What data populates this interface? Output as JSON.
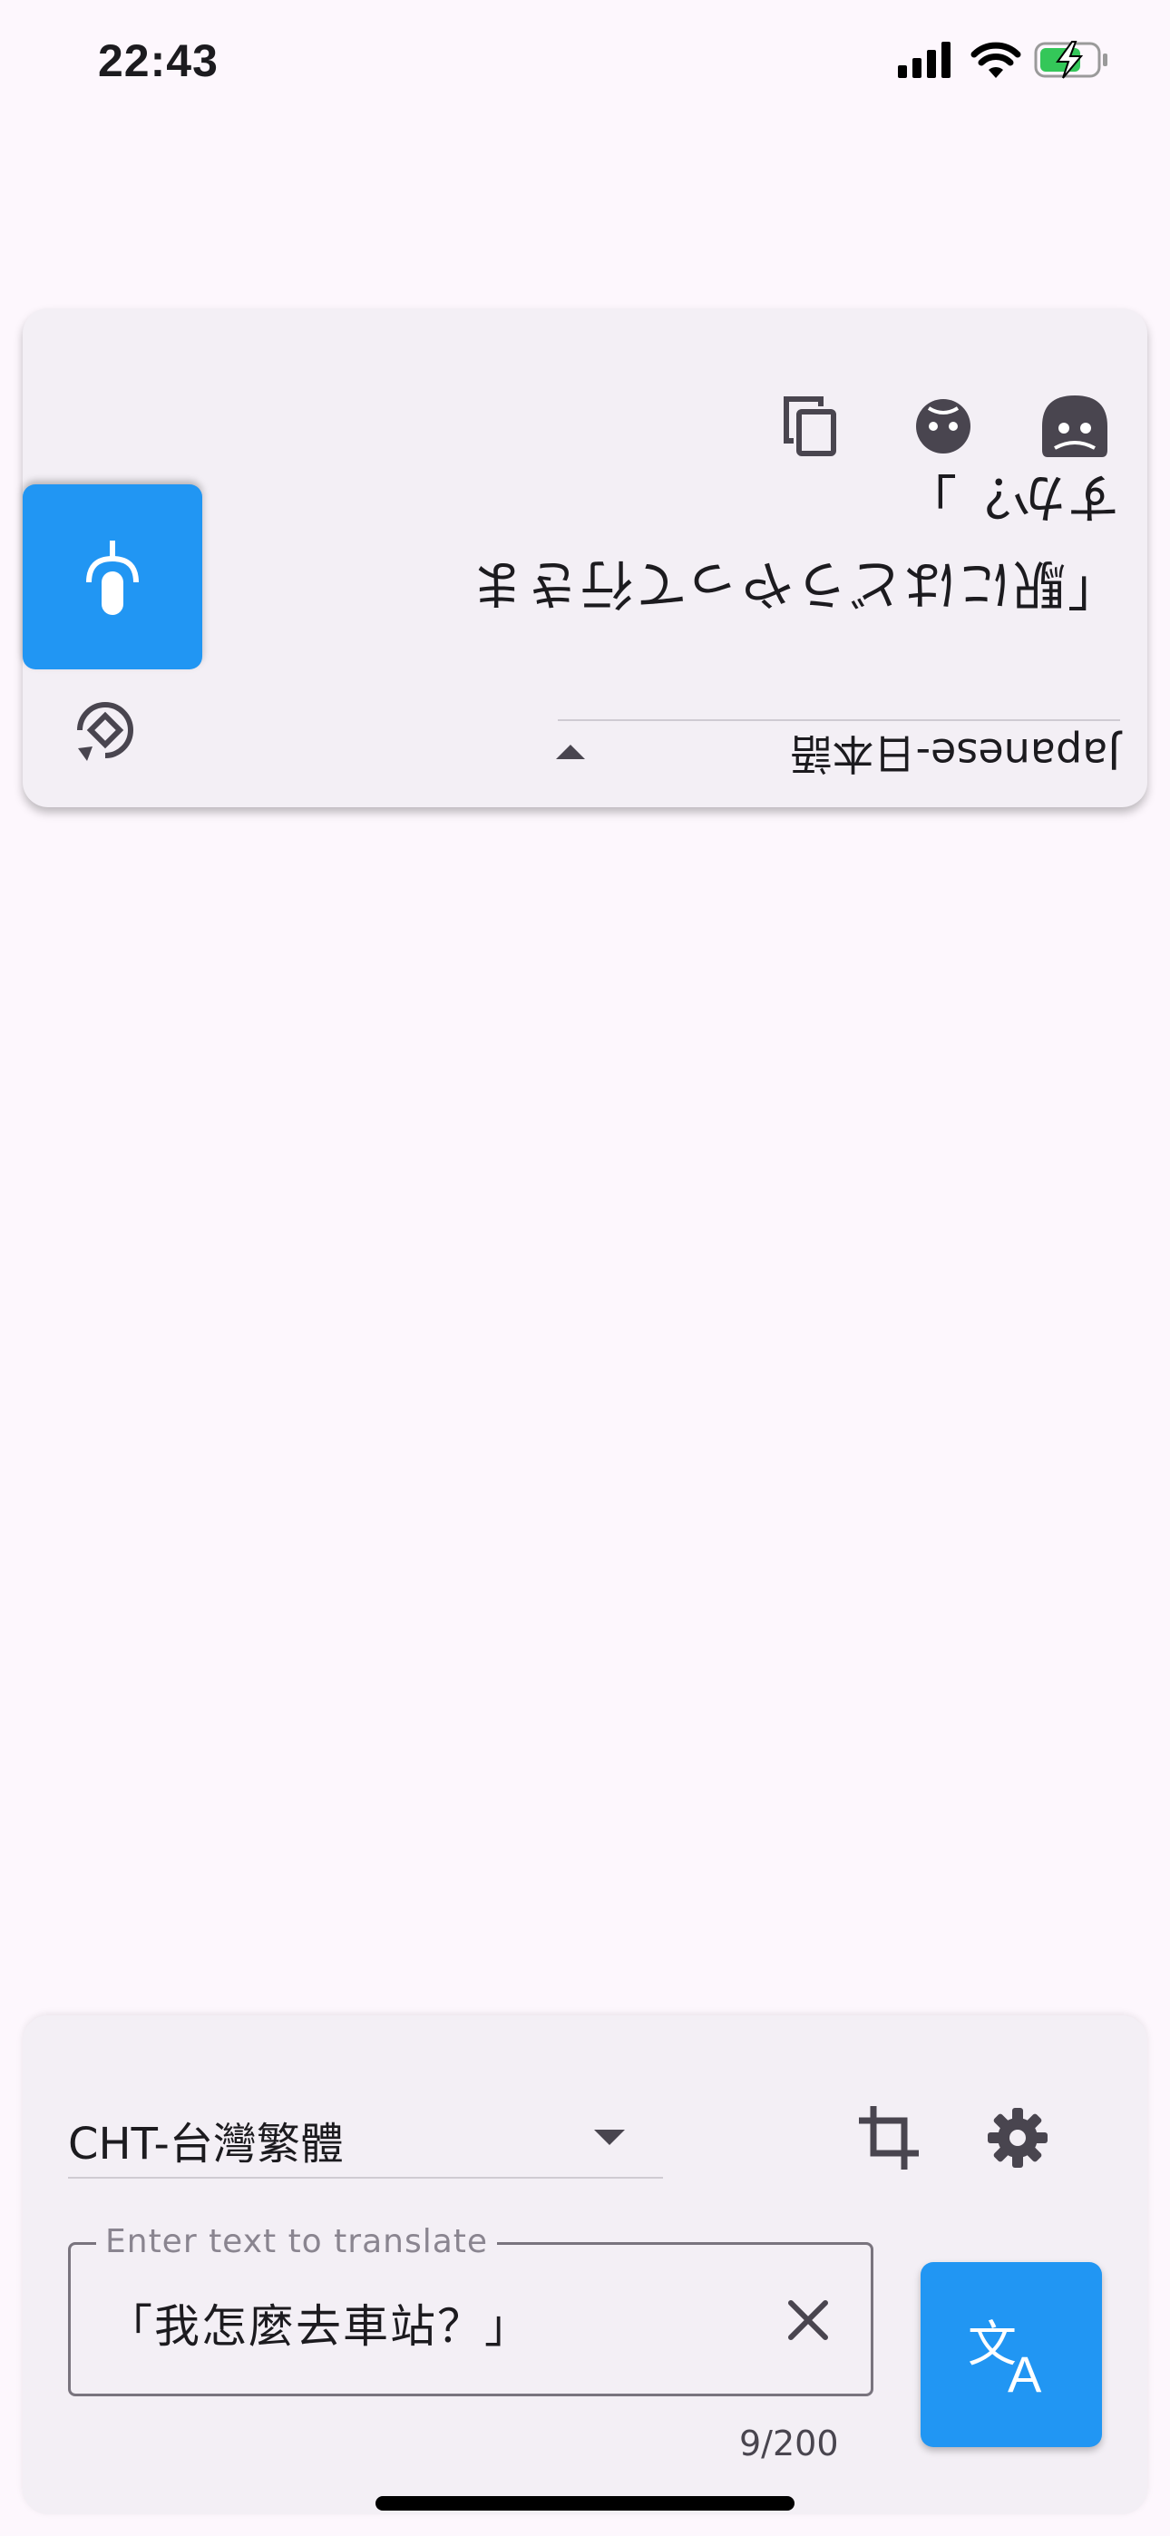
{
  "status_bar": {
    "time": "22:43"
  },
  "output_card": {
    "translated_text": "「駅にはどうやって行きますか？」",
    "language": "Japanese-日本語",
    "icons": [
      "copy-icon",
      "chat-bubble-icon",
      "face-icon",
      "mic-icon",
      "rotate-icon",
      "dropdown-arrow-icon"
    ]
  },
  "input_panel": {
    "language": "CHT-台灣繁體",
    "input_label": "Enter text to translate",
    "input_value": "「我怎麼去車站？」",
    "counter": "9/200",
    "icons": [
      "crop-icon",
      "gear-icon",
      "clear-icon",
      "translate-icon",
      "dropdown-arrow-icon"
    ]
  },
  "colors": {
    "accent": "#2196f3",
    "background": "#fdf7fd",
    "card": "#f3eff5"
  }
}
